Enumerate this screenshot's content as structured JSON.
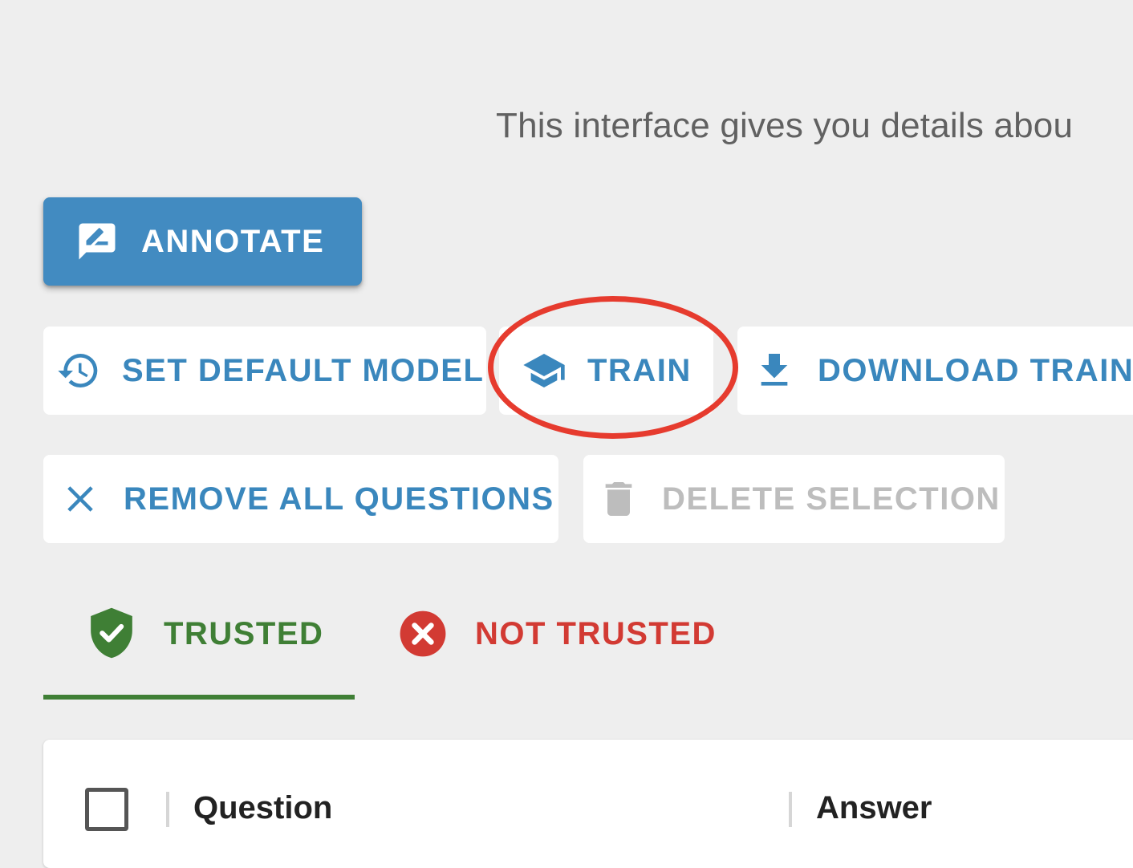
{
  "intro_text": "This interface gives you details abou",
  "colors": {
    "primary": "#428bc1",
    "flat_text": "#3a87bd",
    "disabled": "#bdbdbd",
    "trusted": "#3f7f35",
    "not_trusted": "#d23a33",
    "highlight_circle": "#e63b2e"
  },
  "actions": {
    "annotate": {
      "label": "ANNOTATE",
      "icon": "rate-review-icon"
    },
    "set_default_model": {
      "label": "SET DEFAULT MODEL",
      "icon": "history-icon"
    },
    "train": {
      "label": "TRAIN",
      "icon": "school-icon"
    },
    "download_train": {
      "label": "DOWNLOAD TRAIN",
      "icon": "download-icon"
    },
    "remove_all_questions": {
      "label": "REMOVE ALL QUESTIONS",
      "icon": "close-icon"
    },
    "delete_selection": {
      "label": "DELETE SELECTION",
      "icon": "trash-icon",
      "disabled": true
    }
  },
  "tabs": [
    {
      "label": "TRUSTED",
      "icon": "shield-check-icon",
      "active": true
    },
    {
      "label": "NOT TRUSTED",
      "icon": "cancel-icon",
      "active": false
    }
  ],
  "table": {
    "columns": [
      "Question",
      "Answer"
    ],
    "select_all_checked": false
  }
}
